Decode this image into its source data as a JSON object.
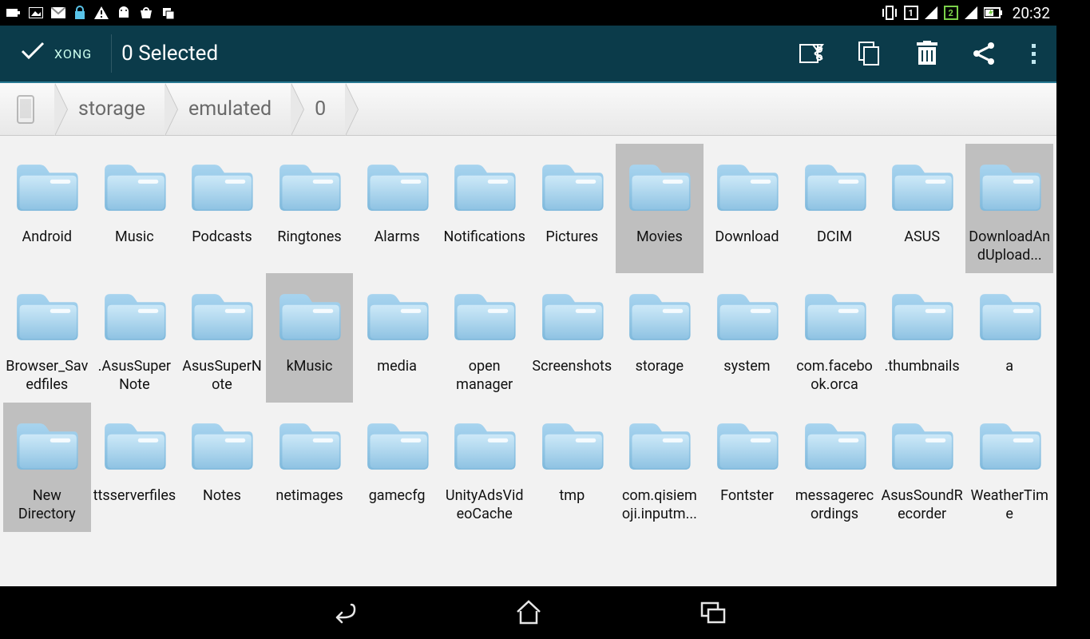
{
  "status": {
    "time": "20:32"
  },
  "actionbar": {
    "done_label": "XONG",
    "selected_text": "0 Selected"
  },
  "breadcrumb": {
    "items": [
      "storage",
      "emulated",
      "0"
    ]
  },
  "folders": [
    {
      "name": "Android",
      "selected": false
    },
    {
      "name": "Music",
      "selected": false
    },
    {
      "name": "Podcasts",
      "selected": false
    },
    {
      "name": "Ringtones",
      "selected": false
    },
    {
      "name": "Alarms",
      "selected": false
    },
    {
      "name": "Notifications",
      "selected": false
    },
    {
      "name": "Pictures",
      "selected": false
    },
    {
      "name": "Movies",
      "selected": true
    },
    {
      "name": "Download",
      "selected": false
    },
    {
      "name": "DCIM",
      "selected": false
    },
    {
      "name": "ASUS",
      "selected": false
    },
    {
      "name": "DownloadAndUpload...",
      "selected": true
    },
    {
      "name": "Browser_Savedfiles",
      "selected": false
    },
    {
      "name": ".AsusSuperNote",
      "selected": false
    },
    {
      "name": "AsusSuperNote",
      "selected": false
    },
    {
      "name": "kMusic",
      "selected": true
    },
    {
      "name": "media",
      "selected": false
    },
    {
      "name": "open manager",
      "selected": false
    },
    {
      "name": "Screenshots",
      "selected": false
    },
    {
      "name": "storage",
      "selected": false
    },
    {
      "name": "system",
      "selected": false
    },
    {
      "name": "com.facebook.orca",
      "selected": false
    },
    {
      "name": ".thumbnails",
      "selected": false
    },
    {
      "name": "a",
      "selected": false
    },
    {
      "name": "New Directory",
      "selected": true
    },
    {
      "name": "ttsserverfiles",
      "selected": false
    },
    {
      "name": "Notes",
      "selected": false
    },
    {
      "name": "netimages",
      "selected": false
    },
    {
      "name": "gamecfg",
      "selected": false
    },
    {
      "name": "UnityAdsVideoCache",
      "selected": false
    },
    {
      "name": "tmp",
      "selected": false
    },
    {
      "name": "com.qisiemoji.inputm...",
      "selected": false
    },
    {
      "name": "Fontster",
      "selected": false
    },
    {
      "name": "messagerecordings",
      "selected": false
    },
    {
      "name": "AsusSoundRecorder",
      "selected": false
    },
    {
      "name": "WeatherTime",
      "selected": false
    }
  ]
}
